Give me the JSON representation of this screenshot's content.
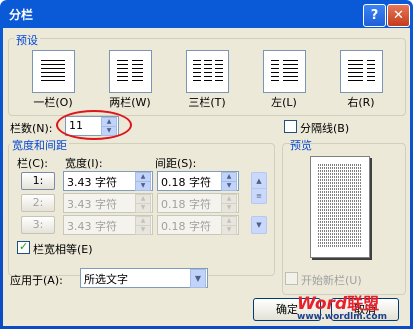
{
  "window": {
    "title": "分栏",
    "help_glyph": "?",
    "close_glyph": "✕"
  },
  "presets": {
    "group_label": "预设",
    "items": [
      {
        "label": "一栏(O)"
      },
      {
        "label": "两栏(W)"
      },
      {
        "label": "三栏(T)"
      },
      {
        "label": "左(L)"
      },
      {
        "label": "右(R)"
      }
    ]
  },
  "columns": {
    "label": "栏数(N):",
    "value": "11",
    "highlight_color": "#e0141b"
  },
  "line_between": {
    "label": "分隔线(B)",
    "checked": false
  },
  "width_spacing": {
    "group_label": "宽度和间距",
    "col_header": "栏(C):",
    "width_header": "宽度(I):",
    "spacing_header": "间距(S):",
    "rows": [
      {
        "col": "1:",
        "width": "3.43 字符",
        "spacing": "0.18 字符"
      },
      {
        "col": "2:",
        "width": "3.43 字符",
        "spacing": "0.18 字符"
      },
      {
        "col": "3:",
        "width": "3.43 字符",
        "spacing": "0.18 字符"
      }
    ]
  },
  "equal_width": {
    "label": "栏宽相等(E)",
    "checked": true
  },
  "apply_to": {
    "label": "应用于(A):",
    "value": "所选文字"
  },
  "preview": {
    "label": "预览"
  },
  "new_column": {
    "label": "开始新栏(U)"
  },
  "buttons": {
    "ok": "确定",
    "cancel": "取消"
  },
  "watermark": {
    "word": "Word",
    "cn": "联盟",
    "url": "www.wordlm.com"
  }
}
